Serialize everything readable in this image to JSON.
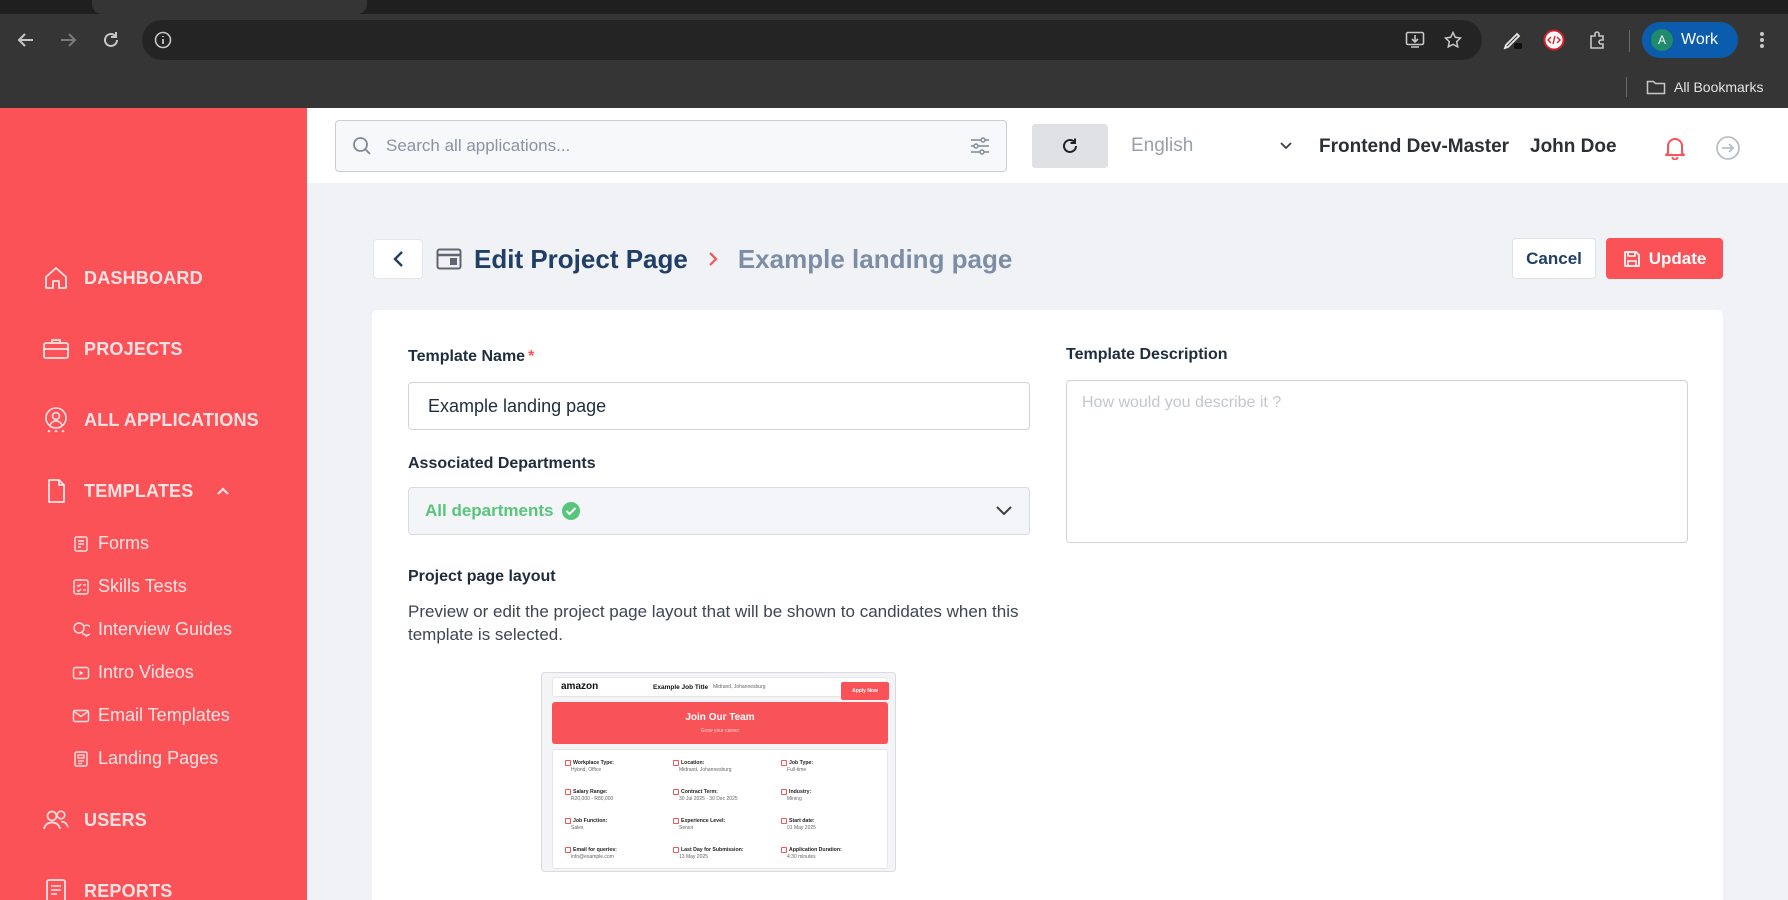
{
  "browser": {
    "profile_initial": "A",
    "profile_name": "Work",
    "bookmarks_label": "All Bookmarks"
  },
  "sidebar": {
    "items": [
      {
        "label": "DASHBOARD",
        "icon": "home-icon"
      },
      {
        "label": "PROJECTS",
        "icon": "briefcase-icon"
      },
      {
        "label": "ALL APPLICATIONS",
        "icon": "applicant-icon"
      },
      {
        "label": "TEMPLATES",
        "icon": "document-icon"
      },
      {
        "label": "USERS",
        "icon": "users-icon"
      },
      {
        "label": "REPORTS",
        "icon": "report-icon"
      }
    ],
    "template_subitems": [
      {
        "label": "Forms",
        "icon": "form-icon"
      },
      {
        "label": "Skills Tests",
        "icon": "checklist-icon"
      },
      {
        "label": "Interview Guides",
        "icon": "chat-icon"
      },
      {
        "label": "Intro Videos",
        "icon": "video-icon"
      },
      {
        "label": "Email Templates",
        "icon": "mail-icon"
      },
      {
        "label": "Landing Pages",
        "icon": "page-icon"
      }
    ]
  },
  "header": {
    "search_placeholder": "Search all applications...",
    "language": "English",
    "project": "Frontend Dev-Master",
    "user": "John Doe"
  },
  "page": {
    "title": "Edit Project Page",
    "subtitle": "Example landing page",
    "cancel_label": "Cancel",
    "update_label": "Update"
  },
  "form": {
    "template_name_label": "Template Name",
    "required_mark": "*",
    "template_name_value": "Example landing page",
    "departments_label": "Associated Departments",
    "departments_value": "All departments",
    "layout_label": "Project page layout",
    "layout_description": "Preview or edit the project page layout that will be shown to candidates when this template is selected.",
    "description_label": "Template Description",
    "description_placeholder": "How would you describe it ?"
  },
  "preview": {
    "logo": "amazon",
    "job_title": "Example Job Title",
    "location": "Midrand, Johannesburg",
    "apply_label": "Apply Now",
    "hero_title": "Join Our Team",
    "hero_sub": "Grow your career",
    "fields": [
      {
        "k": "Workplace Type:",
        "v": "Hybrid, Office"
      },
      {
        "k": "Location:",
        "v": "Midrand, Johannesburg"
      },
      {
        "k": "Job Type:",
        "v": "Full-time"
      },
      {
        "k": "Salary Range:",
        "v": "R20,000 - R80,000"
      },
      {
        "k": "Contract Term:",
        "v": "30 Jul 2025 - 30 Dec 2025"
      },
      {
        "k": "Industry:",
        "v": "Mining"
      },
      {
        "k": "Job Function:",
        "v": "Sales"
      },
      {
        "k": "Experience Level:",
        "v": "Senior"
      },
      {
        "k": "Start date:",
        "v": "01 May 2025"
      },
      {
        "k": "Email for queries:",
        "v": "info@example.com"
      },
      {
        "k": "Last Day for Submission:",
        "v": "13 May 2025"
      },
      {
        "k": "Application Duration:",
        "v": "4:30 minutes"
      }
    ]
  },
  "colors": {
    "accent": "#fb5258",
    "success": "#58c67a",
    "title": "#1f3f66"
  }
}
